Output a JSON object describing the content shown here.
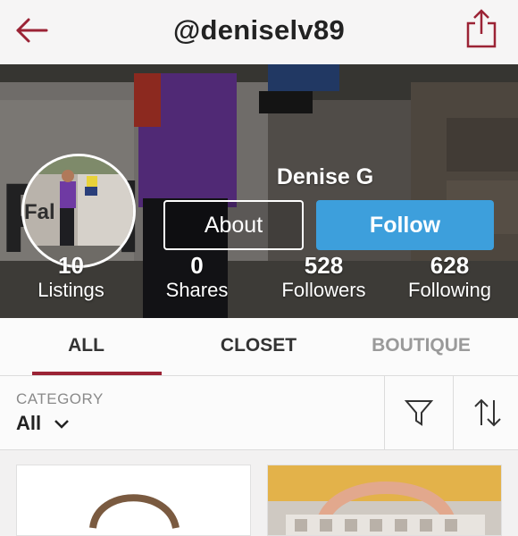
{
  "header": {
    "title": "@deniselv89",
    "back_icon": "back-arrow-icon",
    "share_icon": "share-icon",
    "accent": "#9b2335"
  },
  "profile": {
    "name": "Denise G",
    "about_label": "About",
    "follow_label": "Follow",
    "follow_color": "#3d9fdc"
  },
  "stats": [
    {
      "value": "10",
      "label": "Listings"
    },
    {
      "value": "0",
      "label": "Shares"
    },
    {
      "value": "528",
      "label": "Followers"
    },
    {
      "value": "628",
      "label": "Following"
    }
  ],
  "tabs": [
    {
      "label": "ALL",
      "active": true
    },
    {
      "label": "CLOSET",
      "active": false
    },
    {
      "label": "BOUTIQUE",
      "active": false
    }
  ],
  "filter": {
    "category_label": "CATEGORY",
    "category_value": "All",
    "filter_icon": "filter-icon",
    "sort_icon": "sort-icon"
  }
}
